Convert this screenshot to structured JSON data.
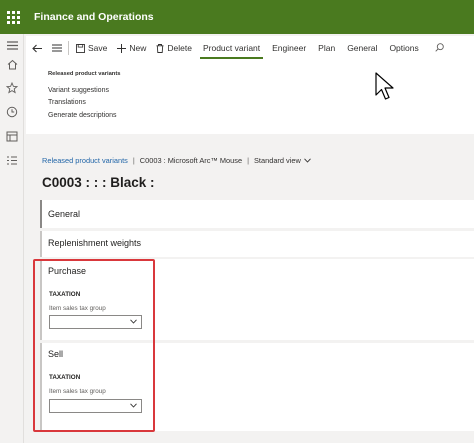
{
  "app": {
    "title": "Finance and Operations",
    "brand_color": "#4a7a1f"
  },
  "nav": {
    "icons": [
      "hamburger-icon",
      "home-icon",
      "star-icon",
      "clock-icon",
      "workspace-icon",
      "list-icon"
    ]
  },
  "toolbar": {
    "save_label": "Save",
    "new_label": "New",
    "delete_label": "Delete",
    "tabs": [
      {
        "label": "Product variant",
        "active": true
      },
      {
        "label": "Engineer",
        "active": false
      },
      {
        "label": "Plan",
        "active": false
      },
      {
        "label": "General",
        "active": false
      },
      {
        "label": "Options",
        "active": false
      }
    ]
  },
  "action_group": {
    "title": "Released product variants",
    "links": [
      "Variant suggestions",
      "Translations",
      "Generate descriptions"
    ]
  },
  "breadcrumb": {
    "root": "Released product variants",
    "separator": "|",
    "record": "C0003 : Microsoft Arc™ Mouse",
    "view": "Standard view"
  },
  "page_title": "C0003 : : : Black :",
  "fasttabs": {
    "general": "General",
    "replenishment": "Replenishment weights",
    "purchase": {
      "label": "Purchase",
      "section": "TAXATION",
      "field_label": "Item sales tax group",
      "field_value": ""
    },
    "sell": {
      "label": "Sell",
      "section": "TAXATION",
      "field_label": "Item sales tax group",
      "field_value": ""
    }
  },
  "highlight_color": "#d9383c"
}
